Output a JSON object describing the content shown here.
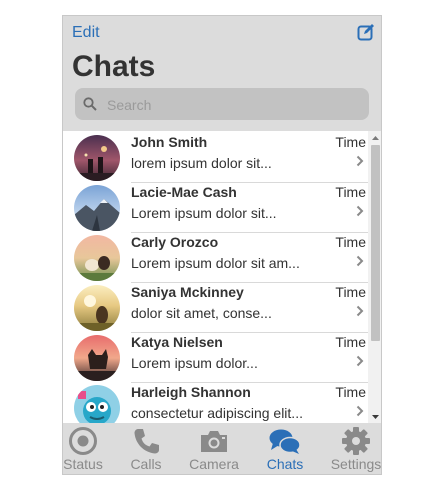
{
  "header": {
    "edit_label": "Edit",
    "title": "Chats",
    "compose_icon": "compose-icon"
  },
  "search": {
    "placeholder": "Search",
    "value": ""
  },
  "chats": [
    {
      "name": "John Smith",
      "preview": "lorem ipsum dolor sit...",
      "time": "Time"
    },
    {
      "name": "Lacie-Mae Cash",
      "preview": "Lorem ipsum dolor sit...",
      "time": "Time"
    },
    {
      "name": "Carly Orozco",
      "preview": "Lorem ipsum dolor sit am...",
      "time": "Time"
    },
    {
      "name": "Saniya Mckinney",
      "preview": "dolor sit amet, conse...",
      "time": "Time"
    },
    {
      "name": "Katya Nielsen",
      "preview": "Lorem ipsum dolor...",
      "time": "Time"
    },
    {
      "name": "Harleigh Shannon",
      "preview": "consectetur adipiscing elit...",
      "time": "Time"
    }
  ],
  "tabs": [
    {
      "label": "Status",
      "icon": "status-icon",
      "active": false
    },
    {
      "label": "Calls",
      "icon": "phone-icon",
      "active": false
    },
    {
      "label": "Camera",
      "icon": "camera-icon",
      "active": false
    },
    {
      "label": "Chats",
      "icon": "chat-bubbles-icon",
      "active": true
    },
    {
      "label": "Settings",
      "icon": "gear-icon",
      "active": false
    }
  ],
  "colors": {
    "accent": "#2b6fb7",
    "header_bg": "#dcdcdc",
    "tab_inactive": "#8a8a8a"
  }
}
